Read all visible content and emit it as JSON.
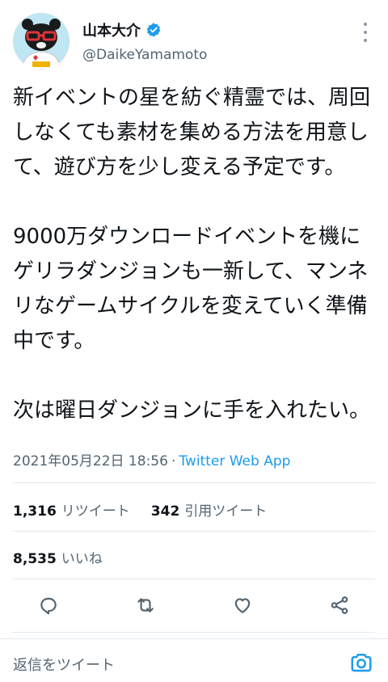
{
  "author": {
    "display_name": "山本大介",
    "handle": "@DaikeYamamoto",
    "verified": true,
    "avatar_icon": "bear-mascot-avatar"
  },
  "tweet": {
    "paragraphs": [
      "新イベントの星を紡ぐ精霊では、周回しなくても素材を集める方法を用意して、遊び方を少し変える予定です。",
      "9000万ダウンロードイベントを機にゲリラダンジョンも一新して、マンネリなゲームサイクルを変えていく準備中です。",
      "次は曜日ダンジョンに手を入れたい。"
    ],
    "timestamp": "2021年05月22日 18:56",
    "separator": "·",
    "source": "Twitter Web App"
  },
  "stats": {
    "retweets_count": "1,316",
    "retweets_label": "リツイート",
    "quotes_count": "342",
    "quotes_label": "引用ツイート",
    "likes_count": "8,535",
    "likes_label": "いいね"
  },
  "actions": [
    {
      "icon": "reply-icon"
    },
    {
      "icon": "retweet-icon"
    },
    {
      "icon": "like-icon"
    },
    {
      "icon": "share-icon"
    }
  ],
  "reply_bar": {
    "placeholder": "返信をツイート",
    "camera_icon": "camera-icon"
  },
  "colors": {
    "accent": "#1d9bf0",
    "text_primary": "#0f1419",
    "text_secondary": "#536471",
    "divider": "#e1e8ed"
  }
}
